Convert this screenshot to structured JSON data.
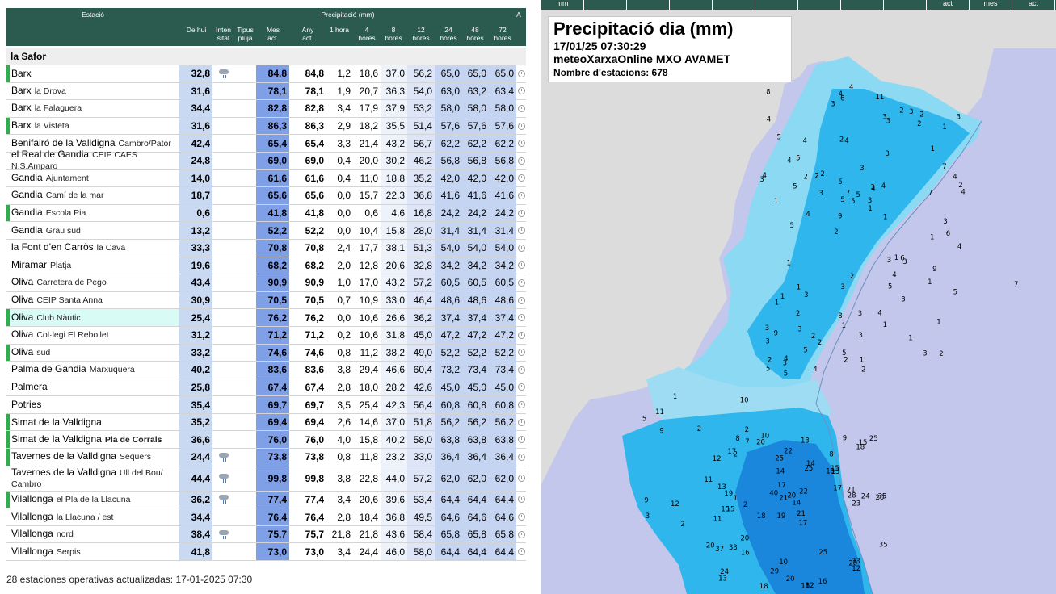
{
  "table": {
    "headers": {
      "estacio": "Estació",
      "precipitacio": "Precipitació (mm)",
      "a": "A",
      "de_hui": "De hui",
      "intensitat": "Inten sitat",
      "tipus_pluja": "Tipus pluja",
      "mes_act": "Mes act.",
      "any_act": "Any act.",
      "h1": "1 hora",
      "h4": "4 hores",
      "h8": "8 hores",
      "h12": "12 hores",
      "h24": "24 hores",
      "h48": "48 hores",
      "h72": "72 hores"
    },
    "region": "la Safor",
    "footer": "28 estaciones operativas actualizadas: 17-01-2025 07:30",
    "rows": [
      {
        "town": "Barx",
        "sub": "",
        "bar": true,
        "rain": true,
        "dehui": "32,8",
        "mes": "84,8",
        "any": "84,8",
        "h1": "1,2",
        "h4": "18,6",
        "h8": "37,0",
        "h12": "56,2",
        "h24": "65,0",
        "h48": "65,0",
        "h72": "65,0"
      },
      {
        "town": "Barx",
        "sub": "la Drova",
        "bar": false,
        "rain": false,
        "dehui": "31,6",
        "mes": "78,1",
        "any": "78,1",
        "h1": "1,9",
        "h4": "20,7",
        "h8": "36,3",
        "h12": "54,0",
        "h24": "63,0",
        "h48": "63,2",
        "h72": "63,4"
      },
      {
        "town": "Barx",
        "sub": "la Falaguera",
        "bar": false,
        "rain": false,
        "dehui": "34,4",
        "mes": "82,8",
        "any": "82,8",
        "h1": "3,4",
        "h4": "17,9",
        "h8": "37,9",
        "h12": "53,2",
        "h24": "58,0",
        "h48": "58,0",
        "h72": "58,0"
      },
      {
        "town": "Barx",
        "sub": "la Visteta",
        "bar": true,
        "rain": false,
        "dehui": "31,6",
        "mes": "86,3",
        "any": "86,3",
        "h1": "2,9",
        "h4": "18,2",
        "h8": "35,5",
        "h12": "51,4",
        "h24": "57,6",
        "h48": "57,6",
        "h72": "57,6"
      },
      {
        "town": "Benifairó de la Valldigna",
        "sub": "Cambro/Pator",
        "bar": false,
        "rain": false,
        "dehui": "42,4",
        "mes": "65,4",
        "any": "65,4",
        "h1": "3,3",
        "h4": "21,4",
        "h8": "43,2",
        "h12": "56,7",
        "h24": "62,2",
        "h48": "62,2",
        "h72": "62,2"
      },
      {
        "town": "el Real de Gandia",
        "sub": "CEIP CAES N.S.Amparo",
        "bar": false,
        "rain": false,
        "dehui": "24,8",
        "mes": "69,0",
        "any": "69,0",
        "h1": "0,4",
        "h4": "20,0",
        "h8": "30,2",
        "h12": "46,2",
        "h24": "56,8",
        "h48": "56,8",
        "h72": "56,8"
      },
      {
        "town": "Gandia",
        "sub": "Ajuntament",
        "bar": false,
        "rain": false,
        "dehui": "14,0",
        "mes": "61,6",
        "any": "61,6",
        "h1": "0,4",
        "h4": "11,0",
        "h8": "18,8",
        "h12": "35,2",
        "h24": "42,0",
        "h48": "42,0",
        "h72": "42,0"
      },
      {
        "town": "Gandia",
        "sub": "Camí de la mar",
        "bar": false,
        "rain": false,
        "dehui": "18,7",
        "mes": "65,6",
        "any": "65,6",
        "h1": "0,0",
        "h4": "15,7",
        "h8": "22,3",
        "h12": "36,8",
        "h24": "41,6",
        "h48": "41,6",
        "h72": "41,6"
      },
      {
        "town": "Gandia",
        "sub": "Escola Pia",
        "bar": true,
        "rain": false,
        "dehui": "0,6",
        "mes": "41,8",
        "any": "41,8",
        "h1": "0,0",
        "h4": "0,6",
        "h8": "4,6",
        "h12": "16,8",
        "h24": "24,2",
        "h48": "24,2",
        "h72": "24,2"
      },
      {
        "town": "Gandia",
        "sub": "Grau sud",
        "bar": false,
        "rain": false,
        "dehui": "13,2",
        "mes": "52,2",
        "any": "52,2",
        "h1": "0,0",
        "h4": "10,4",
        "h8": "15,8",
        "h12": "28,0",
        "h24": "31,4",
        "h48": "31,4",
        "h72": "31,4"
      },
      {
        "town": "la Font d'en Carròs",
        "sub": "la Cava",
        "bar": false,
        "rain": false,
        "dehui": "33,3",
        "mes": "70,8",
        "any": "70,8",
        "h1": "2,4",
        "h4": "17,7",
        "h8": "38,1",
        "h12": "51,3",
        "h24": "54,0",
        "h48": "54,0",
        "h72": "54,0"
      },
      {
        "town": "Miramar",
        "sub": "Platja",
        "bar": false,
        "rain": false,
        "dehui": "19,6",
        "mes": "68,2",
        "any": "68,2",
        "h1": "2,0",
        "h4": "12,8",
        "h8": "20,6",
        "h12": "32,8",
        "h24": "34,2",
        "h48": "34,2",
        "h72": "34,2"
      },
      {
        "town": "Oliva",
        "sub": "Carretera de Pego",
        "bar": false,
        "rain": false,
        "dehui": "43,4",
        "mes": "90,9",
        "any": "90,9",
        "h1": "1,0",
        "h4": "17,0",
        "h8": "43,2",
        "h12": "57,2",
        "h24": "60,5",
        "h48": "60,5",
        "h72": "60,5"
      },
      {
        "town": "Oliva",
        "sub": "CEIP Santa Anna",
        "bar": false,
        "rain": false,
        "dehui": "30,9",
        "mes": "70,5",
        "any": "70,5",
        "h1": "0,7",
        "h4": "10,9",
        "h8": "33,0",
        "h12": "46,4",
        "h24": "48,6",
        "h48": "48,6",
        "h72": "48,6"
      },
      {
        "town": "Oliva",
        "sub": "Club Nàutic",
        "bar": true,
        "rain": false,
        "hl": true,
        "dehui": "25,4",
        "mes": "76,2",
        "any": "76,2",
        "h1": "0,0",
        "h4": "10,6",
        "h8": "26,6",
        "h12": "36,2",
        "h24": "37,4",
        "h48": "37,4",
        "h72": "37,4"
      },
      {
        "town": "Oliva",
        "sub": "Col·legi El Rebollet",
        "bar": false,
        "rain": false,
        "dehui": "31,2",
        "mes": "71,2",
        "any": "71,2",
        "h1": "0,2",
        "h4": "10,6",
        "h8": "31,8",
        "h12": "45,0",
        "h24": "47,2",
        "h48": "47,2",
        "h72": "47,2"
      },
      {
        "town": "Oliva",
        "sub": "sud",
        "bar": true,
        "rain": false,
        "dehui": "33,2",
        "mes": "74,6",
        "any": "74,6",
        "h1": "0,8",
        "h4": "11,2",
        "h8": "38,2",
        "h12": "49,0",
        "h24": "52,2",
        "h48": "52,2",
        "h72": "52,2"
      },
      {
        "town": "Palma de Gandia",
        "sub": "Marxuquera",
        "bar": false,
        "rain": false,
        "dehui": "40,2",
        "mes": "83,6",
        "any": "83,6",
        "h1": "3,8",
        "h4": "29,4",
        "h8": "46,6",
        "h12": "60,4",
        "h24": "73,2",
        "h48": "73,4",
        "h72": "73,4"
      },
      {
        "town": "Palmera",
        "sub": "",
        "bar": false,
        "rain": false,
        "dehui": "25,8",
        "mes": "67,4",
        "any": "67,4",
        "h1": "2,8",
        "h4": "18,0",
        "h8": "28,2",
        "h12": "42,6",
        "h24": "45,0",
        "h48": "45,0",
        "h72": "45,0"
      },
      {
        "town": "Potries",
        "sub": "",
        "bar": false,
        "rain": false,
        "dehui": "35,4",
        "mes": "69,7",
        "any": "69,7",
        "h1": "3,5",
        "h4": "25,4",
        "h8": "42,3",
        "h12": "56,4",
        "h24": "60,8",
        "h48": "60,8",
        "h72": "60,8"
      },
      {
        "town": "Simat de la Valldigna",
        "sub": "",
        "bar": true,
        "rain": false,
        "dehui": "35,2",
        "mes": "69,4",
        "any": "69,4",
        "h1": "2,6",
        "h4": "14,6",
        "h8": "37,0",
        "h12": "51,8",
        "h24": "56,2",
        "h48": "56,2",
        "h72": "56,2"
      },
      {
        "town": "Simat de la Valldigna",
        "sub": "Pla de Corrals",
        "subBold": true,
        "bar": true,
        "rain": false,
        "dehui": "36,6",
        "mes": "76,0",
        "any": "76,0",
        "h1": "4,0",
        "h4": "15,8",
        "h8": "40,2",
        "h12": "58,0",
        "h24": "63,8",
        "h48": "63,8",
        "h72": "63,8"
      },
      {
        "town": "Tavernes de la Valldigna",
        "sub": "Sequers",
        "bar": true,
        "rain": true,
        "dehui": "24,4",
        "mes": "73,8",
        "any": "73,8",
        "h1": "0,8",
        "h4": "11,8",
        "h8": "23,2",
        "h12": "33,0",
        "h24": "36,4",
        "h48": "36,4",
        "h72": "36,4"
      },
      {
        "town": "Tavernes de la Valldigna",
        "sub": "Ull del Bou/ Cambro",
        "tall": true,
        "bar": false,
        "rain": true,
        "dehui": "44,4",
        "mes": "99,8",
        "any": "99,8",
        "h1": "3,8",
        "h4": "22,8",
        "h8": "44,0",
        "h12": "57,2",
        "h24": "62,0",
        "h48": "62,0",
        "h72": "62,0"
      },
      {
        "town": "Vilallonga",
        "sub": "el Pla de la Llacuna",
        "bar": true,
        "rain": true,
        "dehui": "36,2",
        "mes": "77,4",
        "any": "77,4",
        "h1": "3,4",
        "h4": "20,6",
        "h8": "39,6",
        "h12": "53,4",
        "h24": "64,4",
        "h48": "64,4",
        "h72": "64,4"
      },
      {
        "town": "Vilallonga",
        "sub": "la Llacuna / est",
        "bar": false,
        "rain": false,
        "dehui": "34,4",
        "mes": "76,4",
        "any": "76,4",
        "h1": "2,8",
        "h4": "18,4",
        "h8": "36,8",
        "h12": "49,5",
        "h24": "64,6",
        "h48": "64,6",
        "h72": "64,6"
      },
      {
        "town": "Vilallonga",
        "sub": "nord",
        "bar": false,
        "rain": true,
        "dehui": "38,4",
        "mes": "75,7",
        "any": "75,7",
        "h1": "21,8",
        "h4": "21,8",
        "h8": "43,6",
        "h12": "58,4",
        "h24": "65,8",
        "h48": "65,8",
        "h72": "65,8"
      },
      {
        "town": "Vilallonga",
        "sub": "Serpis",
        "bar": false,
        "rain": false,
        "dehui": "41,8",
        "mes": "73,0",
        "any": "73,0",
        "h1": "3,4",
        "h4": "24,4",
        "h8": "46,0",
        "h12": "58,0",
        "h24": "64,4",
        "h48": "64,4",
        "h72": "64,4"
      }
    ]
  },
  "map": {
    "tabs": [
      "mm",
      "",
      "",
      "",
      "",
      "",
      "",
      "",
      "",
      "act",
      "mes",
      "act"
    ],
    "title": "Precipitació dia (mm)",
    "datetime": "17/01/25 07:30:29",
    "source": "meteoXarxaOnline MXO AVAMET",
    "stations_count": "Nombre d'estacions: 678",
    "colors": {
      "sea": "#c4c7ec",
      "land_outside": "#dcdcdc",
      "rain_light": "#8cd9f4",
      "rain_mid": "#2fb6ec",
      "rain_heavy": "#1a86dc"
    },
    "labels_north": [
      "2",
      "1",
      "1",
      "2",
      "3",
      "4",
      "2",
      "3",
      "1",
      "2",
      "3",
      "3",
      "4",
      "4",
      "3",
      "5",
      "6",
      "4",
      "3",
      "7",
      "9",
      "8",
      "5",
      "4",
      "2",
      "3",
      "3",
      "1",
      "6",
      "2",
      "2",
      "5",
      "5",
      "5",
      "4",
      "3",
      "2",
      "1",
      "1",
      "1",
      "1",
      "3",
      "4",
      "1",
      "2",
      "5",
      "5",
      "3",
      "2",
      "4",
      "4",
      "4",
      "5",
      "3",
      "3",
      "11",
      "3",
      "7",
      "5",
      "3",
      "2",
      "1",
      "2",
      "3",
      "8",
      "4",
      "4",
      "5",
      "3",
      "5",
      "9",
      "1",
      "9",
      "5",
      "7",
      "2",
      "1",
      "1",
      "4",
      "4",
      "6",
      "4",
      "3",
      "5",
      "1",
      "3",
      "2",
      "3",
      "3",
      "5",
      "4",
      "3",
      "2",
      "1",
      "1",
      "2",
      "3",
      "2",
      "3",
      "1",
      "4"
    ],
    "labels_south": [
      "10",
      "8",
      "20",
      "19",
      "17",
      "15",
      "12",
      "13",
      "11",
      "25",
      "14",
      "13",
      "20",
      "18",
      "16",
      "12",
      "10",
      "9",
      "17",
      "20",
      "19",
      "15",
      "35",
      "24",
      "20",
      "13",
      "21",
      "28",
      "33",
      "37",
      "20",
      "14",
      "33",
      "40",
      "25",
      "35",
      "21",
      "29",
      "25",
      "22",
      "24",
      "18",
      "16",
      "17",
      "20",
      "13",
      "12",
      "15",
      "11",
      "21",
      "25",
      "23",
      "22",
      "18",
      "13",
      "16",
      "17",
      "20",
      "15",
      "14"
    ],
    "labels_sea": [
      "7"
    ],
    "labels_west": [
      "1",
      "2",
      "2",
      "2",
      "3",
      "1",
      "8",
      "12",
      "10",
      "9",
      "7",
      "5",
      "2",
      "2",
      "9",
      "11"
    ]
  }
}
